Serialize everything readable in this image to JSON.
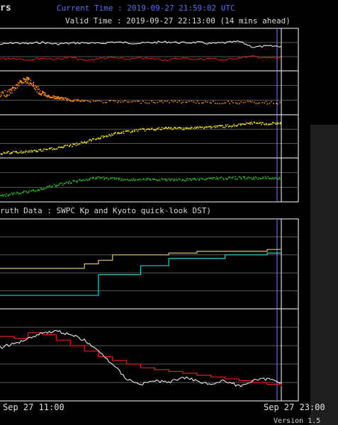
{
  "header": {
    "title_fragment": "rs",
    "current_time": "Current Time : 2019-09-27 21:59:02 UTC",
    "valid_time": "Valid Time : 2019-09-27 22:13:00 (14 mins ahead)"
  },
  "section_title": "ruth Data : SWPC Kp and Kyoto quick-look DST)",
  "version": "Version 1.5",
  "colors": {
    "background": "#000000",
    "axes": "#ffffff",
    "grid": "#5a5a5a",
    "now_line": "#8080ff",
    "white_series": "#ffffff",
    "red_series": "#e02020",
    "orange_series": "#ff8c1a",
    "yellow_series": "#f0e020",
    "green_series": "#2eb82e",
    "tan_series": "#d8c080",
    "cyan_series": "#30d0d0"
  },
  "chart_data": [
    {
      "type": "line",
      "x": [
        0,
        5,
        10,
        15,
        20,
        25,
        30,
        35,
        40,
        45,
        50,
        55,
        60,
        65,
        70,
        75,
        80,
        85,
        90,
        95,
        100
      ],
      "series": [
        {
          "values": [
            62,
            66,
            64,
            67,
            63,
            65,
            66,
            64,
            68,
            66,
            65,
            67,
            68,
            66,
            67,
            64,
            66,
            69,
            56,
            58,
            58
          ]
        },
        {
          "values": [
            28,
            30,
            26,
            30,
            27,
            32,
            24,
            29,
            31,
            27,
            30,
            28,
            26,
            30,
            27,
            29,
            25,
            31,
            34,
            30,
            30
          ]
        }
      ],
      "ylim": [
        0,
        100
      ]
    },
    {
      "type": "scatter",
      "x": [
        0,
        3,
        5,
        7,
        9,
        10,
        12,
        14,
        16,
        18,
        20,
        22,
        25,
        30,
        40,
        50,
        60,
        70,
        80,
        90,
        100
      ],
      "series": [
        {
          "values": [
            45,
            52,
            62,
            74,
            82,
            78,
            66,
            52,
            45,
            42,
            40,
            38,
            35,
            32,
            31,
            30,
            31,
            30,
            29,
            29,
            28
          ]
        }
      ],
      "ylim": [
        0,
        100
      ]
    },
    {
      "type": "scatter",
      "x": [
        0,
        5,
        10,
        15,
        20,
        25,
        30,
        35,
        40,
        45,
        50,
        55,
        60,
        65,
        70,
        75,
        80,
        85,
        90,
        95,
        100
      ],
      "series": [
        {
          "values": [
            12,
            14,
            16,
            19,
            24,
            30,
            38,
            48,
            56,
            62,
            66,
            68,
            70,
            70,
            71,
            73,
            75,
            77,
            82,
            80,
            82
          ]
        }
      ],
      "ylim": [
        0,
        100
      ]
    },
    {
      "type": "scatter",
      "x": [
        0,
        5,
        10,
        15,
        20,
        25,
        30,
        35,
        40,
        45,
        50,
        55,
        60,
        65,
        70,
        75,
        80,
        85,
        90,
        95,
        100
      ],
      "series": [
        {
          "values": [
            15,
            20,
            24,
            32,
            40,
            46,
            52,
            56,
            54,
            52,
            52,
            52,
            51,
            51,
            53,
            55,
            55,
            56,
            55,
            56,
            55
          ]
        }
      ],
      "ylim": [
        0,
        100
      ]
    },
    {
      "type": "line",
      "step": true,
      "x": [
        0,
        5,
        10,
        15,
        20,
        25,
        30,
        35,
        40,
        45,
        50,
        55,
        60,
        65,
        70,
        75,
        80,
        85,
        90,
        95,
        100
      ],
      "series": [
        {
          "values": [
            45,
            45,
            45,
            45,
            45,
            45,
            50,
            54,
            60,
            60,
            60,
            60,
            62,
            62,
            64,
            64,
            64,
            64,
            64,
            66,
            66
          ]
        },
        {
          "values": [
            15,
            15,
            15,
            15,
            15,
            15,
            15,
            38,
            38,
            38,
            48,
            48,
            56,
            56,
            56,
            56,
            60,
            60,
            60,
            62,
            62
          ]
        }
      ],
      "ylim": [
        0,
        100
      ]
    },
    {
      "type": "line",
      "x": [
        0,
        5,
        10,
        15,
        20,
        25,
        30,
        35,
        40,
        45,
        50,
        55,
        60,
        65,
        70,
        75,
        80,
        85,
        90,
        95,
        100
      ],
      "series": [
        {
          "values": [
            70,
            68,
            74,
            72,
            66,
            60,
            54,
            48,
            44,
            40,
            36,
            34,
            32,
            30,
            28,
            26,
            24,
            22,
            20,
            18,
            16
          ]
        },
        {
          "values": [
            58,
            62,
            68,
            74,
            76,
            72,
            66,
            54,
            40,
            24,
            18,
            22,
            20,
            26,
            22,
            18,
            22,
            16,
            22,
            24,
            20
          ]
        }
      ],
      "ylim": [
        0,
        100
      ]
    }
  ],
  "x_ticks": [
    "Sep 27 11:00",
    "Sep 27 23:00"
  ]
}
